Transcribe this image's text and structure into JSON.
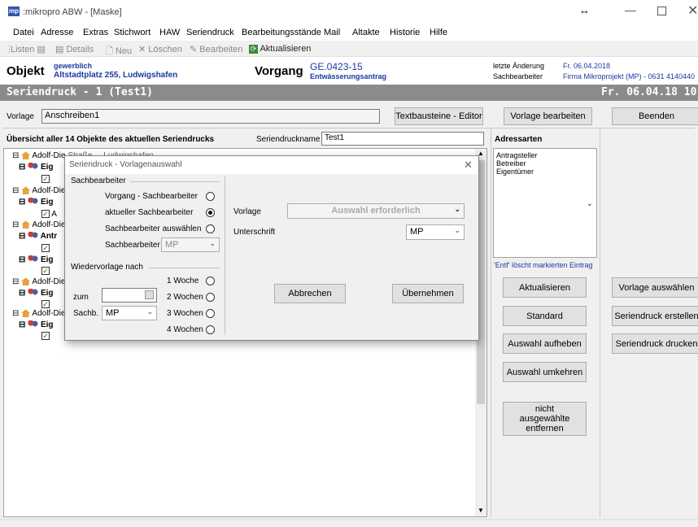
{
  "window": {
    "title": ":mikropro ABW - [Maske]",
    "logo": "mp"
  },
  "menu": [
    "Datei",
    "Adresse",
    "Extras",
    "Stichwort",
    "HAW",
    "Seriendruck",
    "Bearbeitungsstände",
    "Mail",
    "Altakte",
    "Historie",
    "Hilfe"
  ],
  "toolbar": {
    "listen": "Listen",
    "details": "Details",
    "neu": "Neu",
    "loeschen": "Löschen",
    "bearbeiten": "Bearbeiten",
    "aktualisieren": "Aktualisieren"
  },
  "info": {
    "objekt_label": "Objekt",
    "objekt_line1": "gewerblich",
    "objekt_line2": "Altstadtplatz 255, Ludwigshafen",
    "vorgang_label": "Vorgang",
    "vorgang_line1": "GE.0423-15",
    "vorgang_line2": "Entwässerungsantrag",
    "aenderung_label": "letzte Änderung",
    "aenderung_value": "Fr. 06.04.2018",
    "sb_label": "Sachbearbeiter",
    "sb_value": "Firma Mikroprojekt (MP) - 0631 4140440"
  },
  "banner": {
    "left": "Seriendruck - 1 (Test1)",
    "right": "Fr. 06.04.18 10:2"
  },
  "main": {
    "vorlage_label": "Vorlage",
    "vorlage_value": "Anschreiben1",
    "textbausteine_btn": "Textbausteine - Editor",
    "vorlage_bearbeiten_btn": "Vorlage bearbeiten",
    "beenden_btn": "Beenden",
    "uebersicht": "Übersicht aller 14 Objekte des aktuellen Seriendrucks",
    "seriendruckname_label": "Seriendruckname",
    "seriendruckname_value": "Test1",
    "tree": [
      {
        "kind": "obj",
        "text": "Adolf-Die"
      },
      {
        "kind": "grp",
        "text": "Eig"
      },
      {
        "kind": "chk",
        "text": ""
      },
      {
        "kind": "obj",
        "text": "Adolf-Die"
      },
      {
        "kind": "grp",
        "text": "Eig"
      },
      {
        "kind": "chk",
        "text": "A"
      },
      {
        "kind": "obj",
        "text": "Adolf-Die"
      },
      {
        "kind": "grp",
        "text": "Antr"
      },
      {
        "kind": "chk",
        "text": ""
      },
      {
        "kind": "grp",
        "text": "Eig"
      },
      {
        "kind": "chk",
        "text": ""
      },
      {
        "kind": "obj",
        "text": "Adolf-Die"
      },
      {
        "kind": "grp",
        "text": "Eig"
      },
      {
        "kind": "chk",
        "text": ""
      },
      {
        "kind": "obj",
        "text": "Adolf-Die"
      },
      {
        "kind": "grp",
        "text": "Eig"
      },
      {
        "kind": "chk",
        "text": ""
      }
    ],
    "tree_header_partial": "Straße  ...   Ludwigshafen"
  },
  "adressarten": {
    "title": "Adressarten",
    "items": [
      "Antragsteller",
      "Betreiber",
      "Eigentümer"
    ],
    "hint": "'Entf' löscht markierten Eintrag",
    "buttons": [
      "Aktualisieren",
      "Standard",
      "Auswahl aufheben",
      "Auswahl umkehren",
      "nicht ausgewählte entfernen"
    ]
  },
  "right_buttons": [
    "Vorlage auswählen",
    "Seriendruck erstellen",
    "Seriendruck drucken"
  ],
  "dialog": {
    "title": "Seriendruck - Vorlagenauswahl",
    "sb_group": "Sachbearbeiter",
    "opt1": "Vorgang - Sachbearbeiter",
    "opt2": "aktueller Sachbearbeiter",
    "opt3": "Sachbearbeiter auswählen",
    "sb_label": "Sachbearbeiter",
    "sb_value": "MP",
    "wv_group": "Wiedervorlage nach",
    "zum_label": "zum",
    "sachb_label": "Sachb.",
    "sachb_value": "MP",
    "weeks": [
      "1 Woche",
      "2 Wochen",
      "3 Wochen",
      "4 Wochen"
    ],
    "vorlage_label": "Vorlage",
    "vorlage_placeholder": "Auswahl erforderlich",
    "unterschrift_label": "Unterschrift",
    "unterschrift_value": "MP",
    "abbrechen": "Abbrechen",
    "uebernehmen": "Übernehmen"
  }
}
